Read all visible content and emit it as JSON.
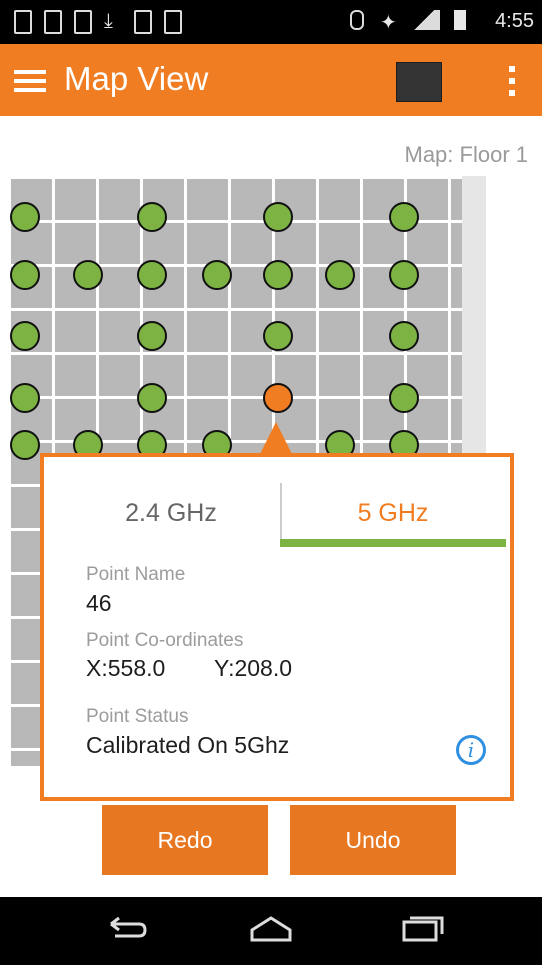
{
  "status_bar": {
    "time": "4:55"
  },
  "app_bar": {
    "menu_icon": "hamburger-icon",
    "title": "Map View",
    "map_icon": "map-select-icon",
    "overflow_icon": "more-vert-icon"
  },
  "map_label": "Map: Floor 1",
  "popup": {
    "tabs": [
      {
        "label": "2.4 GHz"
      },
      {
        "label": "5 GHz"
      }
    ],
    "point_name_label": "Point Name",
    "point_name": "46",
    "coords_label": "Point Co-ordinates",
    "coords_x": "X:558.0",
    "coords_y": "Y:208.0",
    "status_label": "Point Status",
    "status_value": "Calibrated On 5Ghz",
    "info_icon": "info-icon",
    "redo_label": "Redo",
    "undo_label": "Undo"
  },
  "colors": {
    "accent": "#f07d22",
    "point_green": "#7cb342",
    "info_blue": "#2f8fe0"
  }
}
